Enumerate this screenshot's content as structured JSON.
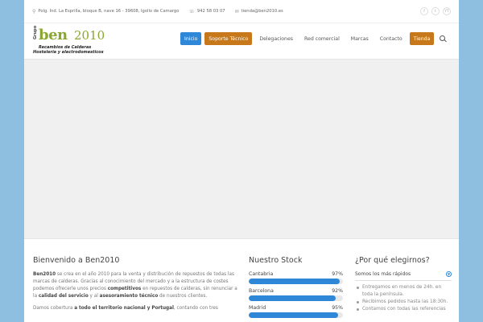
{
  "topbar": {
    "address": "Polg. Ind. La Esprilla, bloque B, nave 16 - 39608, Igollo de Camargo",
    "phone": "942 58 03 07",
    "email": "tienda@ben2010.es",
    "social": [
      "f",
      "t",
      "YT"
    ]
  },
  "logo": {
    "grupo": "Grupo",
    "name": "ben",
    "year": "2010",
    "line1": "Recambios de Calderas",
    "line2": "Hosteleria y electrodomesticos"
  },
  "nav": {
    "items": [
      "Inicio",
      "Soporte Técnico",
      "Delegaciones",
      "Red comercial",
      "Marcas",
      "Contacto",
      "Tienda"
    ]
  },
  "colors": {
    "blue": "#2f87d8",
    "orange": "#c7781a",
    "brand_green": "#8aa82e"
  },
  "welcome": {
    "title": "Bienvenido a Ben2010",
    "p1_a": "Ben2010",
    "p1_b": " se crea en el año 2010 para la venta y distribución de repuestos de todas las marcas de calderas. Gracias al conocimiento del mercado y a la estructura de costes podemos ofrecerle unos precios ",
    "p1_c": "competitivos",
    "p1_d": " en repuestos de calderas, sin renunciar a la ",
    "p1_e": "calidad del servicio",
    "p1_f": " y al ",
    "p1_g": "asesoramiento técnico",
    "p1_h": " de nuestros clientes.",
    "p2_a": "Damos cobertura ",
    "p2_b": "a todo el territorio nacional y Portugal",
    "p2_c": ", contando con tres"
  },
  "stock": {
    "title": "Nuestro Stock",
    "items": [
      {
        "label": "Cantabria",
        "value": "97%",
        "fraction": 0.97
      },
      {
        "label": "Barcelona",
        "value": "92%",
        "fraction": 0.92
      },
      {
        "label": "Madrid",
        "value": "95%",
        "fraction": 0.95
      }
    ]
  },
  "why": {
    "title": "¿Por qué elegirnos?",
    "section": "Somos los más rápidos",
    "bullets": [
      "Entregamos en menos de 24h. en toda la península.",
      "Recibimos pedidos hasta las 18:30h.",
      "Contamos con todas las referencias"
    ]
  }
}
